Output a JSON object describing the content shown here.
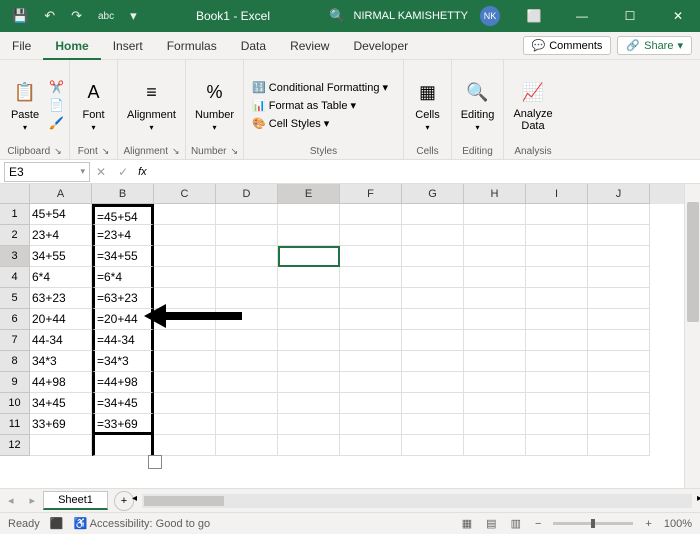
{
  "title": {
    "doc": "Book1",
    "app": "Excel",
    "user": "NIRMAL KAMISHETTY",
    "initials": "NK"
  },
  "qat": {
    "undo": "↶",
    "redo": "↷",
    "sort": "abc"
  },
  "tabs": {
    "file": "File",
    "home": "Home",
    "insert": "Insert",
    "formulas": "Formulas",
    "data": "Data",
    "review": "Review",
    "developer": "Developer"
  },
  "actions": {
    "comments": "Comments",
    "share": "Share"
  },
  "ribbon": {
    "clipboard": {
      "paste": "Paste",
      "label": "Clipboard"
    },
    "font": {
      "btn": "Font",
      "label": "Font"
    },
    "align": {
      "btn": "Alignment",
      "label": "Alignment"
    },
    "number": {
      "btn": "Number",
      "label": "Number"
    },
    "styles": {
      "cond": "Conditional Formatting",
      "table": "Format as Table",
      "cell": "Cell Styles",
      "label": "Styles"
    },
    "cells": {
      "btn": "Cells",
      "label": "Cells"
    },
    "editing": {
      "btn": "Editing",
      "label": "Editing"
    },
    "analysis": {
      "btn": "Analyze\nData",
      "label": "Analysis"
    }
  },
  "namebox": "E3",
  "columns": [
    "A",
    "B",
    "C",
    "D",
    "E",
    "F",
    "G",
    "H",
    "I",
    "J"
  ],
  "rows": [
    {
      "n": "1",
      "a": "45+54",
      "b": "=45+54"
    },
    {
      "n": "2",
      "a": "23+4",
      "b": "=23+4"
    },
    {
      "n": "3",
      "a": "34+55",
      "b": "=34+55"
    },
    {
      "n": "4",
      "a": "6*4",
      "b": "=6*4"
    },
    {
      "n": "5",
      "a": "63+23",
      "b": "=63+23"
    },
    {
      "n": "6",
      "a": "20+44",
      "b": "=20+44"
    },
    {
      "n": "7",
      "a": "44-34",
      "b": "=44-34"
    },
    {
      "n": "8",
      "a": "34*3",
      "b": "=34*3"
    },
    {
      "n": "9",
      "a": "44+98",
      "b": "=44+98"
    },
    {
      "n": "10",
      "a": "34+45",
      "b": "=34+45"
    },
    {
      "n": "11",
      "a": "33+69",
      "b": "=33+69"
    },
    {
      "n": "12",
      "a": "",
      "b": ""
    }
  ],
  "sheet": "Sheet1",
  "status": {
    "ready": "Ready",
    "access": "Accessibility: Good to go",
    "zoom": "100%"
  }
}
